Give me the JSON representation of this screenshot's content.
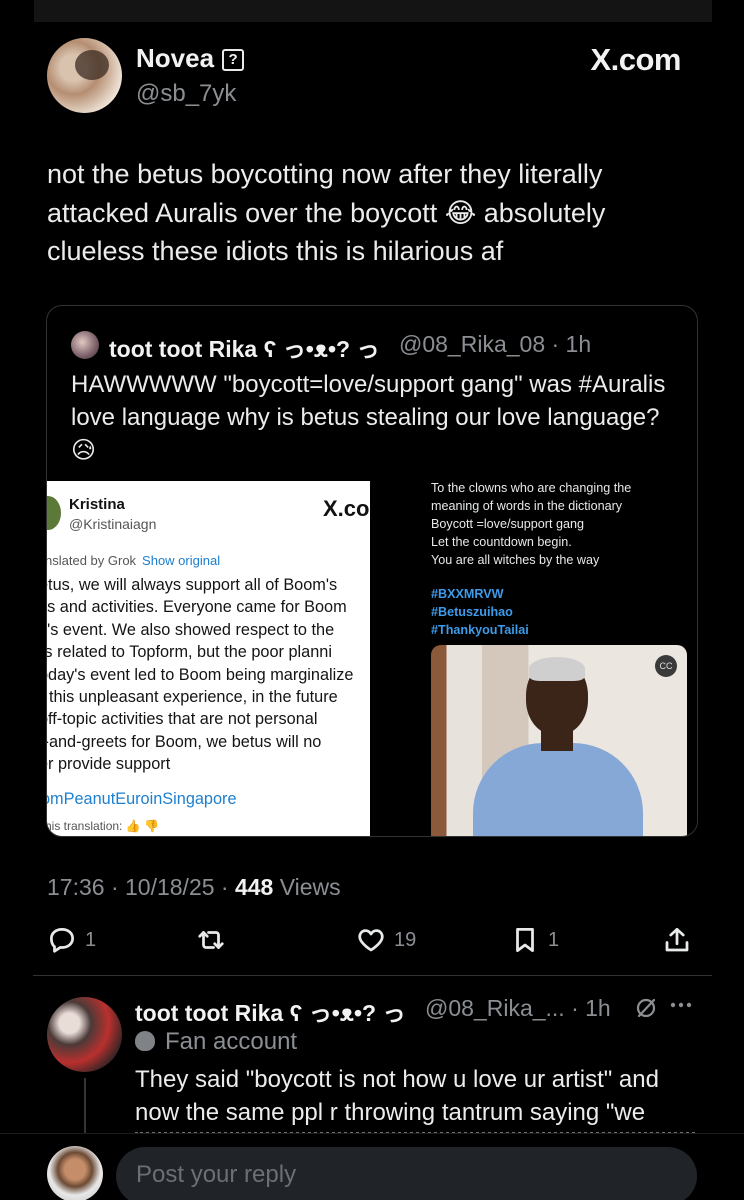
{
  "post": {
    "display_name": "Novea",
    "verified_badge": "?",
    "handle": "@sb_7yk",
    "site": "X.com",
    "text": "not the betus boycotting now after they literally attacked Auralis over the boycott 😂 absolutely clueless these idiots this is hilarious af",
    "timestamp": "17:36 · 10/18/25 · ",
    "views_count": "448",
    "views_label": " Views"
  },
  "quote": {
    "name": "toot toot Rika ʕ っ•ᴥ•? っ",
    "handle": "@08_Rika_08 · 1h",
    "text": "HAWWWWW \"boycott=love/support gang\" was #Auralis love language why is betus stealing our love language? 😥",
    "left_image": {
      "name": "Kristina",
      "handle": "@Kristinaiagn",
      "x_logo": "X.co",
      "translated_label": "nslated by Grok",
      "show_original": "Show original",
      "lines": [
        "etus, we will always support all of Boom's",
        "ks and activities. Everyone came for Boom",
        "y's event. We also showed respect to the",
        "rs related to Topform, but the poor planni",
        "oday's event led to Boom being marginalize",
        "r this unpleasant experience, in the future",
        " off-topic activities that are not personal",
        "t-and-greets for Boom, we betus will no",
        "er provide support"
      ],
      "hashtag": "omPeanutEuroinSingapore",
      "translation_feedback": "his translation: 👍 👎"
    },
    "right_image": {
      "lines": [
        "To the clowns who are changing the",
        "meaning of words in the dictionary",
        "Boycott =love/support gang",
        "Let the countdown begin.",
        "You are all witches by the way"
      ],
      "hashtags": [
        "#BXXMRVW",
        "#Betuszuihao",
        "#ThankyouTailai"
      ],
      "cc_label": "CC"
    }
  },
  "actions": {
    "replies": "1",
    "retweets": "",
    "likes": "19",
    "bookmarks": "1"
  },
  "reply": {
    "name": "toot toot Rika ʕ っ•ᴥ•? っ",
    "handle": "@08_Rika_... · 1h",
    "label": "Fan account",
    "text": "They said \"boycott is not how u love ur artist\" and now the same ppl r throwing tantrum saying \"we"
  },
  "composer": {
    "placeholder": "Post your reply"
  },
  "icons": {
    "reply": "comment-icon",
    "retweet": "retweet-icon",
    "like": "heart-icon",
    "bookmark": "bookmark-icon",
    "share": "share-icon",
    "grok": "grok-icon",
    "more": "more-icon",
    "fan": "mask-icon"
  }
}
